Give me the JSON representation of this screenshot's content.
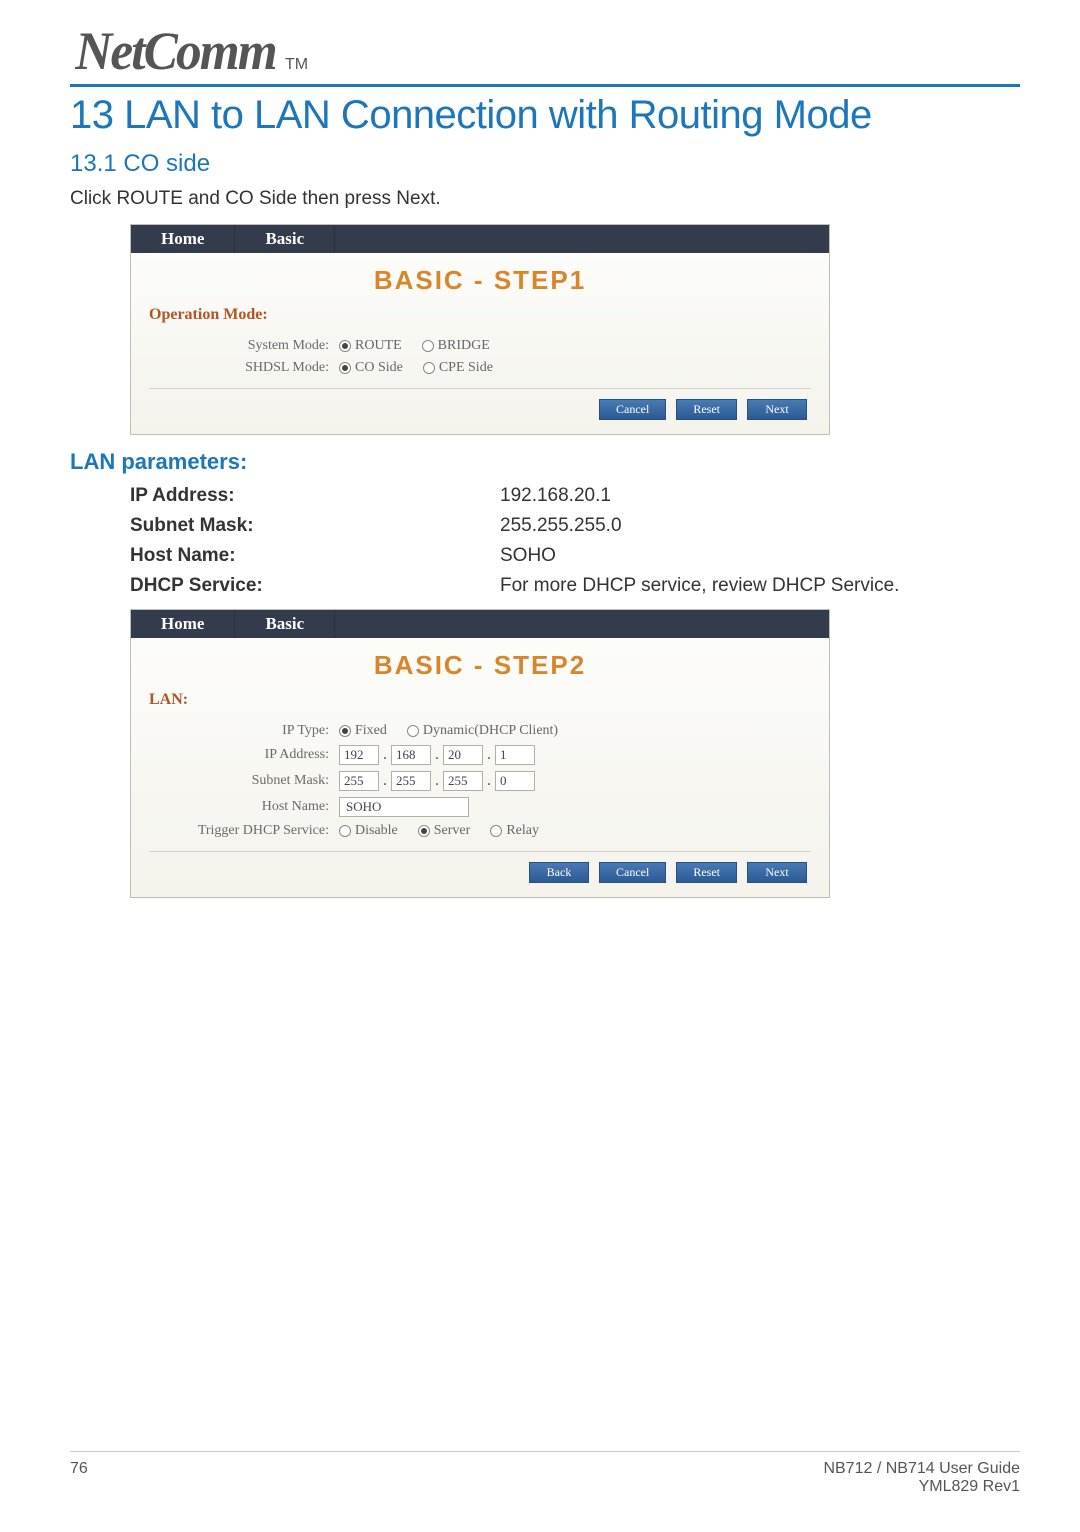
{
  "brand": "NetComm",
  "tm": "TM",
  "chapter_title": "13 LAN to LAN Connection with Routing Mode",
  "section_title": "13.1 CO side",
  "instruction": "Click ROUTE and CO Side then press Next.",
  "tabs": {
    "home": "Home",
    "basic": "Basic"
  },
  "step1": {
    "title": "BASIC - STEP1",
    "group": "Operation Mode:",
    "sys_mode_label": "System Mode:",
    "sys_mode_opts": {
      "route": "ROUTE",
      "bridge": "BRIDGE"
    },
    "sh_label": "SHDSL Mode:",
    "sh_opts": {
      "co": "CO Side",
      "cpe": "CPE Side"
    },
    "btn": {
      "cancel": "Cancel",
      "reset": "Reset",
      "next": "Next"
    }
  },
  "lan_params": {
    "heading": "LAN parameters:",
    "rows": [
      {
        "label": "IP Address:",
        "value": "192.168.20.1"
      },
      {
        "label": "Subnet Mask:",
        "value": "255.255.255.0"
      },
      {
        "label": "Host Name:",
        "value": "SOHO"
      },
      {
        "label": "DHCP Service:",
        "value": "For more DHCP service, review DHCP Service."
      }
    ]
  },
  "step2": {
    "title": "BASIC - STEP2",
    "group": "LAN:",
    "ip_type_label": "IP Type:",
    "ip_type_opts": {
      "fixed": "Fixed",
      "dyn": "Dynamic(DHCP Client)"
    },
    "ip_addr_label": "IP Address:",
    "ip_addr": [
      "192",
      "168",
      "20",
      "1"
    ],
    "mask_label": "Subnet Mask:",
    "mask": [
      "255",
      "255",
      "255",
      "0"
    ],
    "host_label": "Host Name:",
    "host": "SOHO",
    "dhcp_label": "Trigger DHCP Service:",
    "dhcp_opts": {
      "disable": "Disable",
      "server": "Server",
      "relay": "Relay"
    },
    "btn": {
      "back": "Back",
      "cancel": "Cancel",
      "reset": "Reset",
      "next": "Next"
    }
  },
  "footer": {
    "page": "76",
    "guide": "NB712 / NB714 User Guide",
    "rev": "YML829 Rev1"
  }
}
